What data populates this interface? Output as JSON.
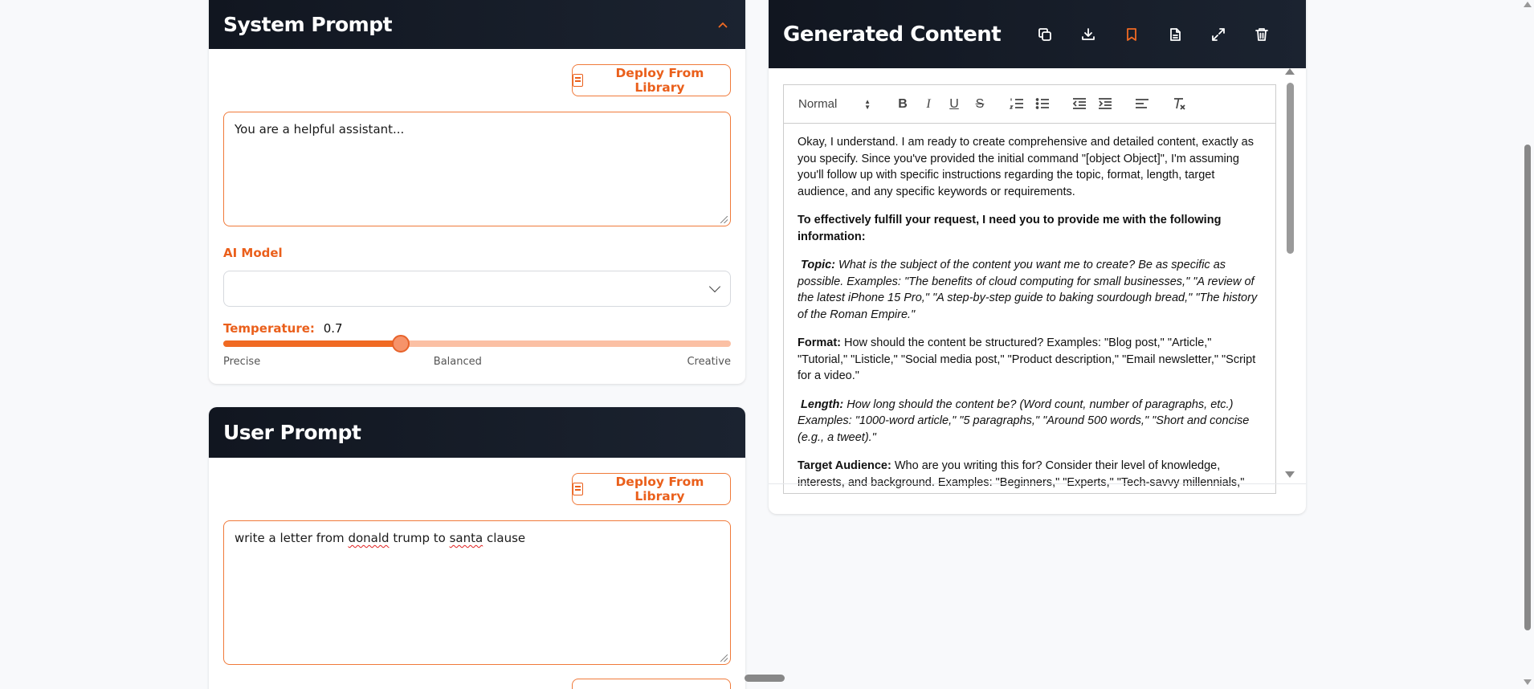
{
  "system_prompt": {
    "title": "System Prompt",
    "collapse_icon": "chevron-up-icon",
    "deploy_label": "Deploy From Library",
    "value": "You are a helpful assistant...",
    "model_label": "AI Model",
    "model_value": "",
    "temperature": {
      "label": "Temperature:",
      "value": "0.7",
      "fraction": 0.35,
      "ticks": [
        "Precise",
        "Balanced",
        "Creative"
      ]
    }
  },
  "user_prompt": {
    "title": "User Prompt",
    "deploy_label": "Deploy From Library",
    "value_parts": [
      "write a letter from ",
      "donald",
      " trump to ",
      "santa",
      " clause"
    ]
  },
  "generated": {
    "title": "Generated Content",
    "tools": [
      "copy-icon",
      "download-icon",
      "bookmark-icon",
      "document-icon",
      "expand-icon",
      "trash-icon"
    ],
    "format_value": "Normal",
    "paragraphs": {
      "p1": "Okay, I understand. I am ready to create comprehensive and detailed content, exactly as you specify. Since you've provided the initial command \"[object Object]\", I'm assuming you'll follow up with specific instructions regarding the topic, format, length, target audience, and any specific keywords or requirements.",
      "p2": "To effectively fulfill your request, I need you to provide me with the following information:",
      "p3_label": "Topic:",
      "p3_text": " What is the subject of the content you want me to create? Be as specific as possible. Examples: \"The benefits of cloud computing for small businesses,\" \"A review of the latest iPhone 15 Pro,\" \"A step-by-step guide to baking sourdough bread,\" \"The history of the Roman Empire.\"",
      "p4_label": "Format:",
      "p4_text": " How should the content be structured? Examples: \"Blog post,\" \"Article,\" \"Tutorial,\" \"Listicle,\" \"Social media post,\" \"Product description,\" \"Email newsletter,\" \"Script for a video.\"",
      "p5_label": "Length:",
      "p5_text": " How long should the content be? (Word count, number of paragraphs, etc.) Examples: \"1000-word article,\" \"5 paragraphs,\" \"Around 500 words,\" \"Short and concise (e.g., a tweet).\"",
      "p6_label": "Target Audience:",
      "p6_text": " Who are you writing this for? Consider their level of knowledge, interests, and background. Examples: \"Beginners,\" \"Experts,\" \"Tech-savvy millennials,\""
    }
  },
  "colors": {
    "accent": "#f06a23",
    "header_dark": "#111620",
    "slider_track": "#fbc0a4"
  }
}
